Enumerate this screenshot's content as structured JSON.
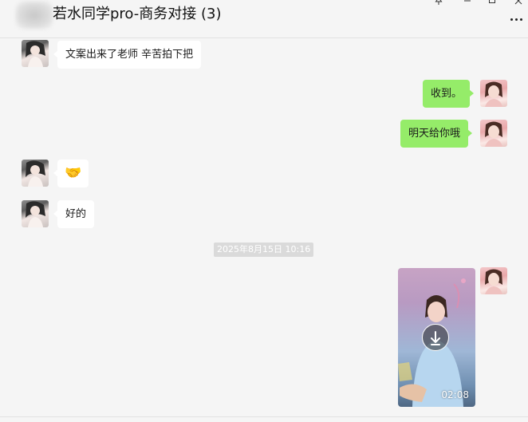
{
  "header": {
    "title": "若水同学pro-商务对接 (3)",
    "controls": [
      "pin-icon",
      "minimize-icon",
      "maximize-icon",
      "close-icon"
    ],
    "more_icon": "more-dots-icon"
  },
  "messages": [
    {
      "sender": "contact",
      "type": "text",
      "text": "文案出来了老师 辛苦拍下把"
    },
    {
      "sender": "self",
      "type": "text",
      "text": "收到。"
    },
    {
      "sender": "self",
      "type": "text",
      "text": "明天给你哦"
    },
    {
      "sender": "contact",
      "type": "emoji",
      "emoji": "🤝"
    },
    {
      "sender": "contact",
      "type": "text",
      "text": "好的"
    },
    {
      "type": "timestamp",
      "text": "2025年8月15日 10:16"
    },
    {
      "sender": "self",
      "type": "video",
      "duration": "02:08"
    }
  ],
  "colors": {
    "background": "#f5f5f5",
    "incoming_bubble": "#ffffff",
    "outgoing_bubble": "#95ec69",
    "timestamp_bg": "#dadada"
  }
}
